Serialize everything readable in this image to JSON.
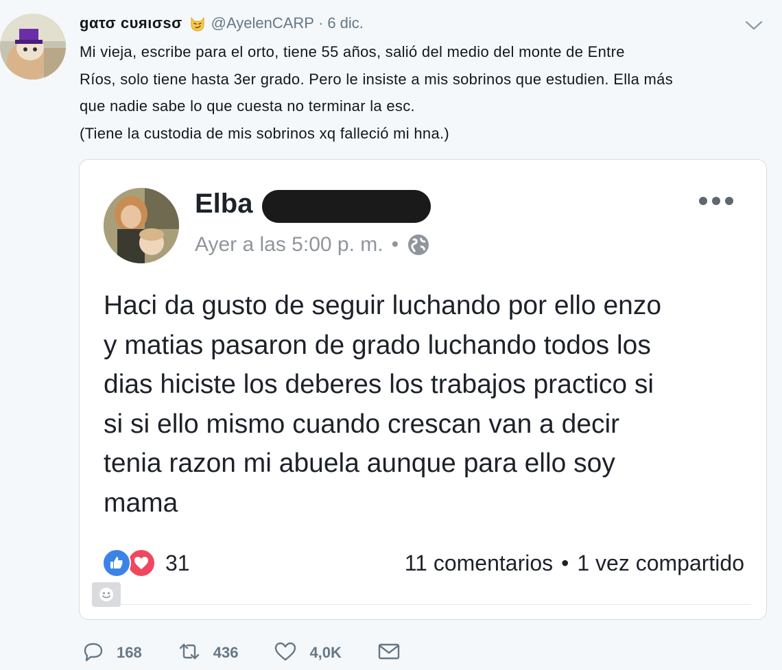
{
  "tweet": {
    "display_name": "gατσ cυяισsσ",
    "emoji_icon": "smirking-cat-face-emoji",
    "handle": "@AyelenCARP",
    "separator": "·",
    "date": "6 dic.",
    "text_lines": [
      "Mi vieja, escribe para el orto, tiene 55 años, salió del medio del monte de Entre",
      "Ríos, solo tiene hasta 3er grado. Pero le insiste a mis sobrinos que estudien. Ella más",
      "que nadie sabe lo que cuesta no terminar la esc.",
      "(Tiene la custodia de mis sobrinos xq falleció mi hna.)"
    ]
  },
  "fb_post": {
    "author": "Elba",
    "time": "Ayer a las 5:00 p. m.",
    "meta_separator": "•",
    "privacy_icon": "globe-icon",
    "body_lines": [
      "Haci da gusto de seguir luchando por ello enzo",
      "y matias pasaron de grado luchando todos los",
      "dias hiciste los deberes los trabajos practico si",
      "si si ello mismo cuando crescan van a decir",
      "tenia razon mi abuela aunque para ello soy",
      "mama"
    ],
    "reaction_count": "31",
    "comments": "11 comentarios",
    "stats_separator": "•",
    "shares": "1 vez compartido"
  },
  "actions": {
    "replies": "168",
    "retweets": "436",
    "likes": "4,0K"
  },
  "colors": {
    "page_bg": "#f5f8fa",
    "text": "#14171a",
    "muted": "#657786",
    "fb_like_blue": "#3b83e6",
    "fb_love_red": "#f0475f"
  }
}
